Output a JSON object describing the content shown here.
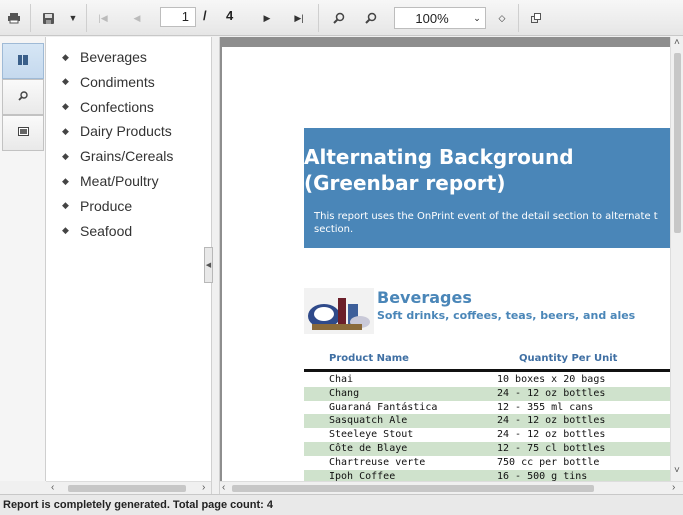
{
  "toolbar": {
    "current_page": "1",
    "separator": "/",
    "total_pages": "4",
    "zoom": "100%"
  },
  "tabs": [
    {
      "icon": "document-map-icon",
      "active": true
    },
    {
      "icon": "search-icon",
      "active": false
    },
    {
      "icon": "thumbnails-icon",
      "active": false
    }
  ],
  "document_map": {
    "items": [
      "Beverages",
      "Condiments",
      "Confections",
      "Dairy Products",
      "Grains/Cereals",
      "Meat/Poultry",
      "Produce",
      "Seafood"
    ]
  },
  "report": {
    "title_line1": "Alternating Background",
    "title_line2": "(Greenbar report)",
    "description_line1": "This report uses the OnPrint event of the detail section to alternate t",
    "description_line2": "section.",
    "category": {
      "name": "Beverages",
      "description": "Soft drinks, coffees, teas, beers, and ales"
    },
    "columns": [
      "Product Name",
      "Quantity Per Unit"
    ],
    "rows": [
      {
        "product": "Chai",
        "qty": "10 boxes x 20 bags"
      },
      {
        "product": "Chang",
        "qty": "24 - 12 oz bottles"
      },
      {
        "product": "Guaraná Fantástica",
        "qty": "12 - 355 ml cans"
      },
      {
        "product": "Sasquatch Ale",
        "qty": "24 - 12 oz bottles"
      },
      {
        "product": "Steeleye Stout",
        "qty": "24 - 12 oz bottles"
      },
      {
        "product": "Côte de Blaye",
        "qty": "12 - 75 cl bottles"
      },
      {
        "product": "Chartreuse verte",
        "qty": "750 cc per bottle"
      },
      {
        "product": "Ipoh Coffee",
        "qty": "16 - 500 g tins"
      }
    ]
  },
  "status": "Report is completely generated. Total page count: 4",
  "colors": {
    "banner": "#4a86b8",
    "greenbar": "#cfe2cc",
    "accent_text": "#4a86b8"
  }
}
